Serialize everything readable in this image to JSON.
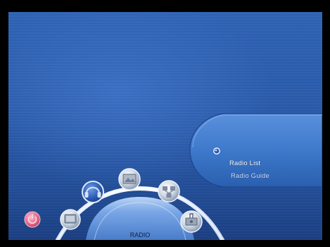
{
  "side_menu": {
    "items": [
      {
        "label": "Radio List",
        "selected": true
      },
      {
        "label": "Radio Guide",
        "selected": false
      }
    ]
  },
  "dock": {
    "section_label": "RADIO",
    "selected_icon": "headphones-icon",
    "icons": [
      "tv-icon",
      "headphones-icon",
      "photo-icon",
      "network-icon",
      "settings-icon"
    ],
    "power_icon": "power-icon"
  },
  "colors": {
    "background": "#2c5eaf",
    "panel": "#3f7acc",
    "dock": "#5c8fdc",
    "selected_ring": "#1e4fa6",
    "power": "#e5678b"
  }
}
